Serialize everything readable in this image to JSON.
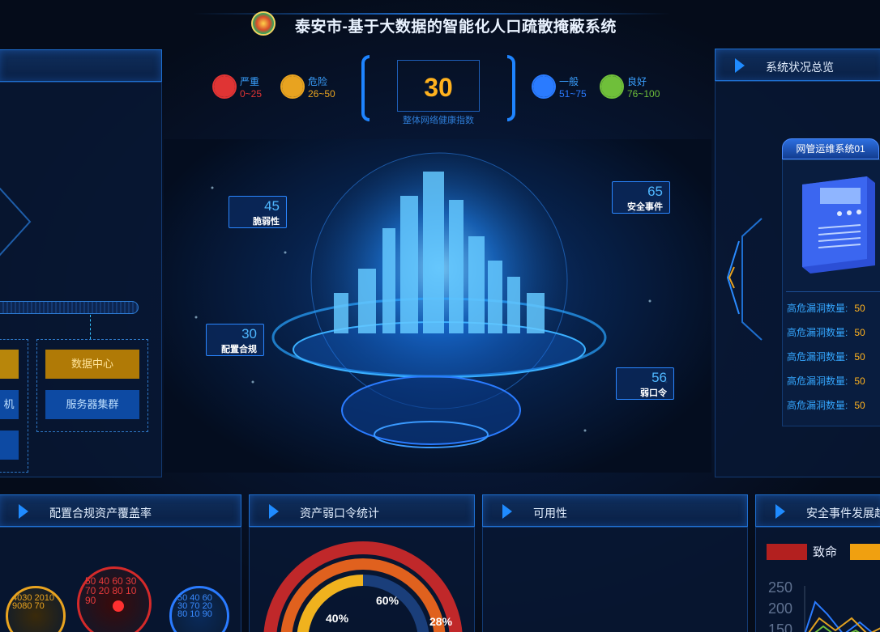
{
  "header": {
    "title": "泰安市-基于大数据的智能化人口疏散掩蔽系统"
  },
  "legend": [
    {
      "name": "严重",
      "range": "0~25",
      "color": "#e03434"
    },
    {
      "name": "危险",
      "range": "26~50",
      "color": "#e8a320"
    },
    {
      "name": "一般",
      "range": "51~75",
      "color": "#2a7bff"
    },
    {
      "name": "良好",
      "range": "76~100",
      "color": "#6fbf3a"
    }
  ],
  "score": {
    "value": "30",
    "caption": "整体网络健康指数"
  },
  "globe_tags": [
    {
      "num": "45",
      "label": "脆弱性"
    },
    {
      "num": "65",
      "label": "安全事件"
    },
    {
      "num": "30",
      "label": "配置合规"
    },
    {
      "num": "56",
      "label": "弱口令"
    }
  ],
  "right_panel": {
    "title": "系统状况总览",
    "system_name": "网管运维系统01",
    "vuln_rows": [
      {
        "label": "高危漏洞数量:",
        "value": "50"
      },
      {
        "label": "高危漏洞数量:",
        "value": "50"
      },
      {
        "label": "高危漏洞数量:",
        "value": "50"
      },
      {
        "label": "高危漏洞数量:",
        "value": "50"
      },
      {
        "label": "高危漏洞数量:",
        "value": "50"
      }
    ]
  },
  "left_panel": {
    "button_data_center": "数据中心",
    "button_server_cluster": "服务器集群",
    "edge_label": "机"
  },
  "bottom_panels": [
    {
      "title": "配置合规资产覆盖率"
    },
    {
      "title": "资产弱口令统计"
    },
    {
      "title": "可用性"
    },
    {
      "title": "安全事件发展趋"
    }
  ],
  "weak_pwd_chart": {
    "label_a": "60%",
    "label_b": "40%",
    "label_c": "28%"
  },
  "trend_chart": {
    "legend_a": "致命",
    "y_ticks": [
      "250",
      "200",
      "150"
    ]
  },
  "gauge_ticks": {
    "left": "4030 2010 9080 70",
    "mid": "50 40 60 30 70 20 80 10 90",
    "right": "50 40 60 30 70 20 80 10 90"
  },
  "colors": {
    "accent": "#1f8bff",
    "warn": "#ffb21e",
    "danger": "#e03434"
  }
}
